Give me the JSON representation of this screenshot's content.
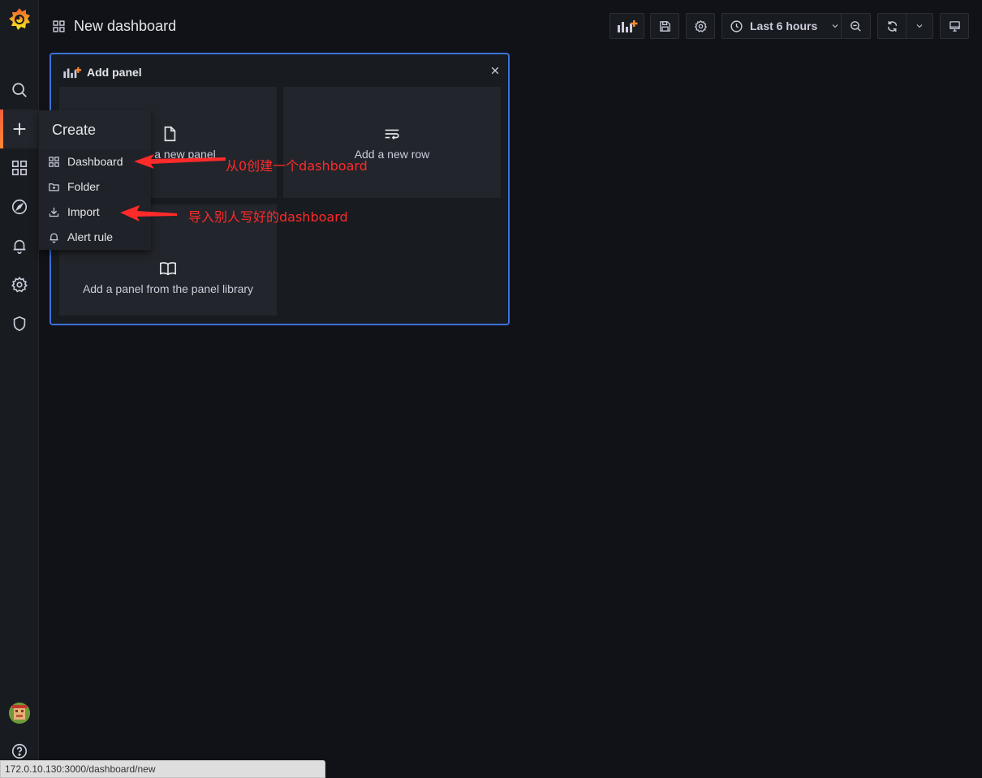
{
  "header": {
    "title": "New dashboard",
    "time_range": "Last 6 hours"
  },
  "add_panel": {
    "title": "Add panel",
    "tiles": {
      "new_panel": "Add a new panel",
      "new_row": "Add a new row",
      "library": "Add a panel from the panel library"
    },
    "visible_new_panel_fragment": "a new panel"
  },
  "create_menu": {
    "title": "Create",
    "items": [
      {
        "label": "Dashboard",
        "icon": "grid-icon"
      },
      {
        "label": "Folder",
        "icon": "folder-plus-icon"
      },
      {
        "label": "Import",
        "icon": "import-icon"
      },
      {
        "label": "Alert rule",
        "icon": "bell-icon"
      }
    ]
  },
  "annotations": {
    "dashboard_note": "从0创建一个dashboard",
    "import_note": "导入别人写好的dashboard"
  },
  "status_url": "172.0.10.130:3000/dashboard/new",
  "colors": {
    "accent_blue": "#3d71d9",
    "annotation_red": "#ff2a2a",
    "active_orange": "#f55f3e",
    "background": "#111217"
  }
}
